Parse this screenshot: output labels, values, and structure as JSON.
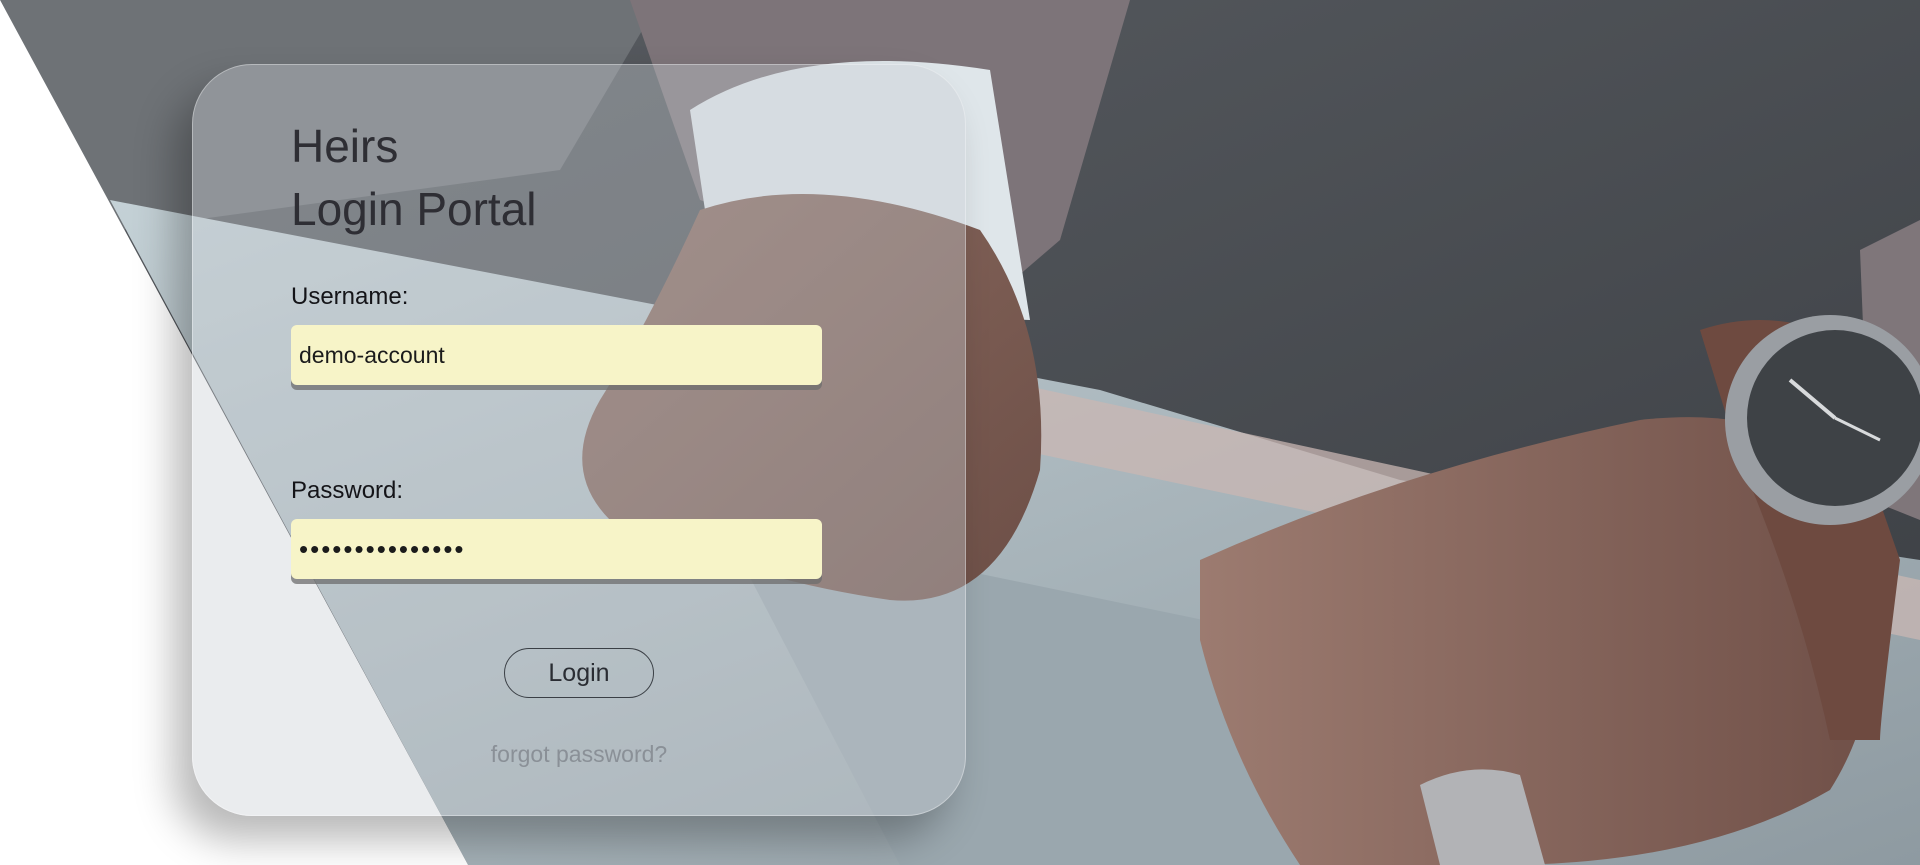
{
  "page": {
    "title_line1": "Heirs",
    "title_line2": "Login Portal"
  },
  "form": {
    "username_label": "Username:",
    "username_value": "demo-account",
    "password_label": "Password:",
    "password_value": "•••••••••••••••",
    "login_label": "Login",
    "forgot_label": "forgot password?"
  },
  "colors": {
    "input_background": "#f7f4c8",
    "title_text": "#2e2e34",
    "forgot_link": "#8a9097",
    "photo_dark": "#3a3f44",
    "photo_light": "#a9b6bd"
  },
  "background": {
    "subject": "person-typing-on-laptop-with-wristwatch-photo"
  }
}
